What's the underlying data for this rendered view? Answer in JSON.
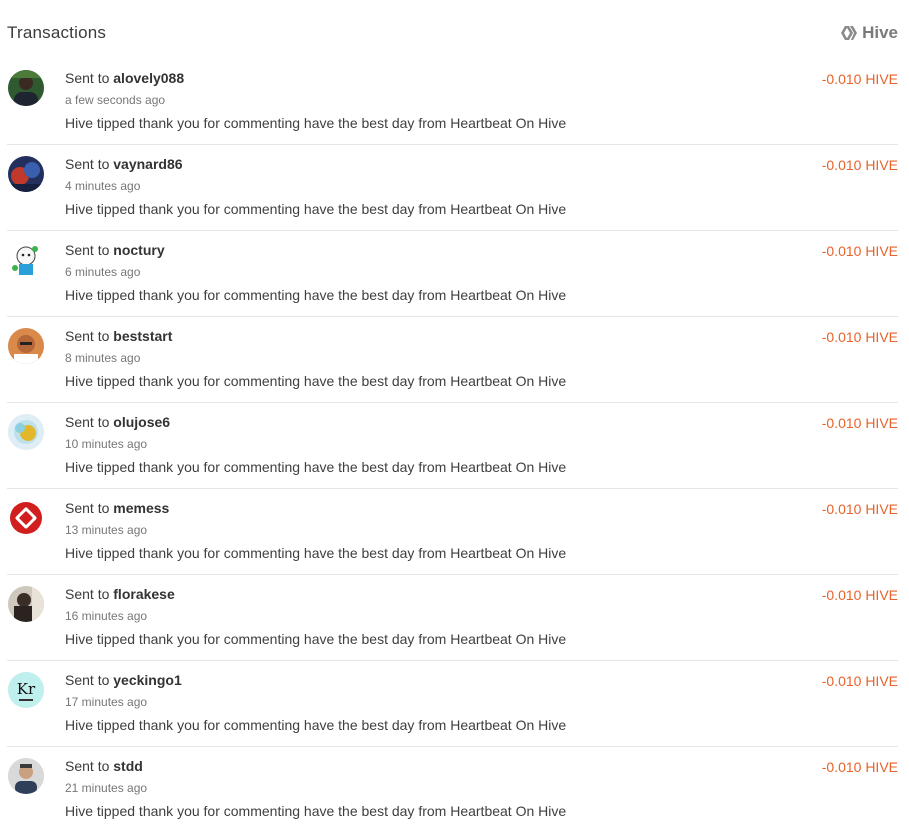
{
  "header": {
    "title": "Transactions",
    "brand_label": "Hive",
    "brand_icon": "hive-logo-icon"
  },
  "colors": {
    "amount": "#e8622a",
    "divider": "#e6e6e6",
    "text": "#3a3a3a",
    "muted": "#777777"
  },
  "transactions": [
    {
      "prefix": "Sent to",
      "user": "alovely088",
      "time": "a few seconds ago",
      "memo": "Hive tipped thank you for commenting have the best day from Heartbeat On Hive",
      "amount": "-0.010 HIVE",
      "avatar": "avatar-photo-icon"
    },
    {
      "prefix": "Sent to",
      "user": "vaynard86",
      "time": "4 minutes ago",
      "memo": "Hive tipped thank you for commenting have the best day from Heartbeat On Hive",
      "amount": "-0.010 HIVE",
      "avatar": "avatar-photo-icon"
    },
    {
      "prefix": "Sent to",
      "user": "noctury",
      "time": "6 minutes ago",
      "memo": "Hive tipped thank you for commenting have the best day from Heartbeat On Hive",
      "amount": "-0.010 HIVE",
      "avatar": "avatar-cartoon-icon"
    },
    {
      "prefix": "Sent to",
      "user": "beststart",
      "time": "8 minutes ago",
      "memo": "Hive tipped thank you for commenting have the best day from Heartbeat On Hive",
      "amount": "-0.010 HIVE",
      "avatar": "avatar-photo-icon"
    },
    {
      "prefix": "Sent to",
      "user": "olujose6",
      "time": "10 minutes ago",
      "memo": "Hive tipped thank you for commenting have the best day from Heartbeat On Hive",
      "amount": "-0.010 HIVE",
      "avatar": "avatar-photo-icon"
    },
    {
      "prefix": "Sent to",
      "user": "memess",
      "time": "13 minutes ago",
      "memo": "Hive tipped thank you for commenting have the best day from Heartbeat On Hive",
      "amount": "-0.010 HIVE",
      "avatar": "avatar-logo-icon"
    },
    {
      "prefix": "Sent to",
      "user": "florakese",
      "time": "16 minutes ago",
      "memo": "Hive tipped thank you for commenting have the best day from Heartbeat On Hive",
      "amount": "-0.010 HIVE",
      "avatar": "avatar-photo-icon"
    },
    {
      "prefix": "Sent to",
      "user": "yeckingo1",
      "time": "17 minutes ago",
      "memo": "Hive tipped thank you for commenting have the best day from Heartbeat On Hive",
      "amount": "-0.010 HIVE",
      "avatar": "avatar-element-icon",
      "avatar_text": "Kr"
    },
    {
      "prefix": "Sent to",
      "user": "stdd",
      "time": "21 minutes ago",
      "memo": "Hive tipped thank you for commenting have the best day from Heartbeat On Hive",
      "amount": "-0.010 HIVE",
      "avatar": "avatar-photo-icon"
    }
  ]
}
